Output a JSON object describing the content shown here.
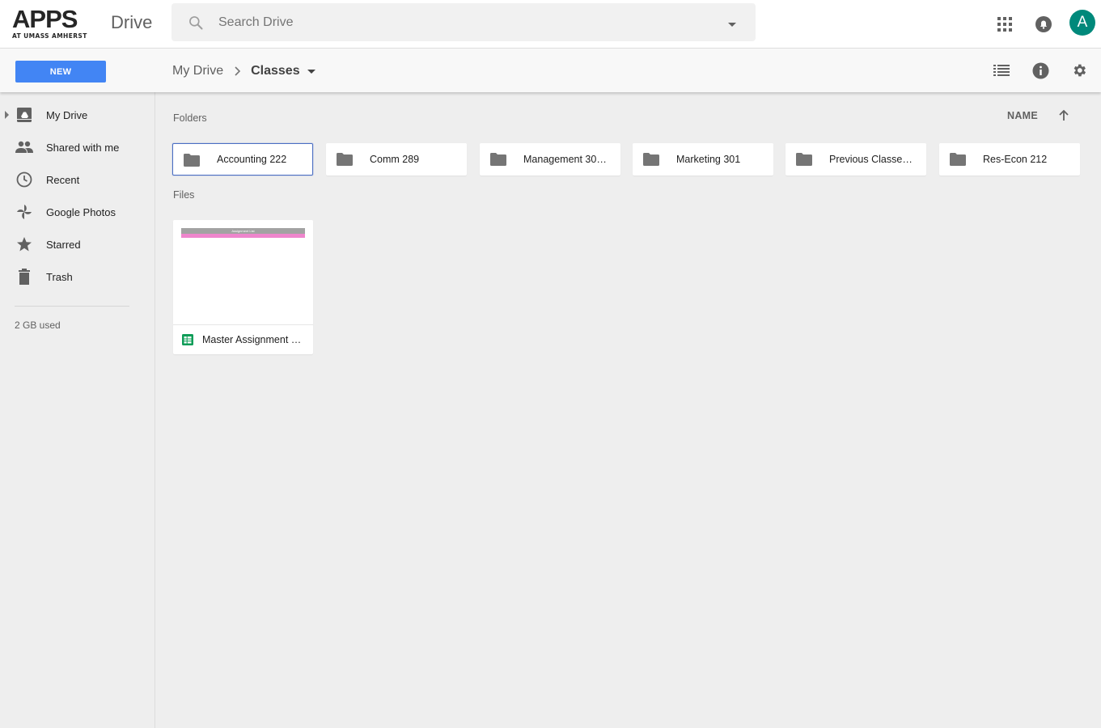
{
  "header": {
    "logo_main": "APPS",
    "logo_sub": "AT UMASS AMHERST",
    "product_name": "Drive",
    "search_placeholder": "Search Drive",
    "avatar_initial": "A"
  },
  "toolbar": {
    "new_label": "NEW",
    "breadcrumb_root": "My Drive",
    "breadcrumb_current": "Classes"
  },
  "sidebar": {
    "items": [
      {
        "label": "My Drive",
        "icon": "drive-icon"
      },
      {
        "label": "Shared with me",
        "icon": "people-icon"
      },
      {
        "label": "Recent",
        "icon": "clock-icon"
      },
      {
        "label": "Google Photos",
        "icon": "pinwheel-icon"
      },
      {
        "label": "Starred",
        "icon": "star-icon"
      },
      {
        "label": "Trash",
        "icon": "trash-icon"
      }
    ],
    "storage": "2 GB used"
  },
  "main": {
    "folders_label": "Folders",
    "files_label": "Files",
    "sort_label": "NAME",
    "folders": [
      {
        "name": "Accounting 222",
        "selected": true
      },
      {
        "name": "Comm 289",
        "selected": false
      },
      {
        "name": "Management 30…",
        "selected": false
      },
      {
        "name": "Marketing 301",
        "selected": false
      },
      {
        "name": "Previous Classe…",
        "selected": false
      },
      {
        "name": "Res-Econ 212",
        "selected": false
      }
    ],
    "files": [
      {
        "name": "Master Assignment …",
        "type": "spreadsheet",
        "thumb_title": "Assignment List"
      }
    ]
  },
  "colors": {
    "accent": "#4285f4",
    "avatar": "#00897b",
    "logo_accent": "#d64a26",
    "sheets_green": "#0f9d58",
    "thumb_pink": "#ee86cc"
  }
}
